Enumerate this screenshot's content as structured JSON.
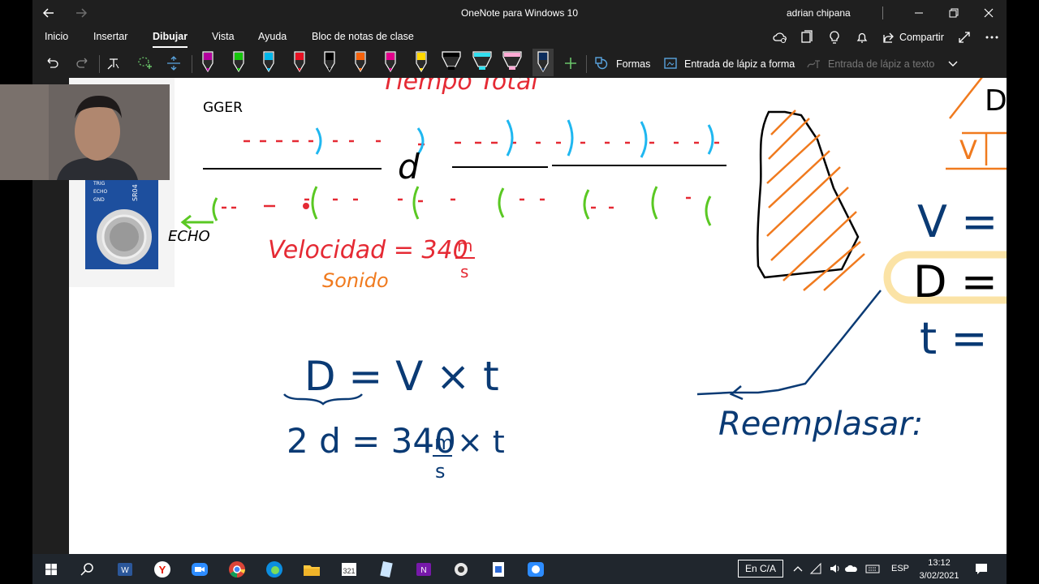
{
  "window": {
    "title": "OneNote para Windows 10",
    "user": "adrian chipana"
  },
  "menu": {
    "tabs": [
      "Inicio",
      "Insertar",
      "Dibujar",
      "Vista",
      "Ayuda",
      "Bloc de notas de clase"
    ],
    "active_tab": "Dibujar",
    "share_label": "Compartir"
  },
  "toolbar": {
    "shapes_label": "Formas",
    "ink_to_shape_label": "Entrada de lápiz a forma",
    "ink_to_text_label": "Entrada de lápiz a texto",
    "pens": [
      {
        "name": "pen-magenta",
        "color": "#b4009e"
      },
      {
        "name": "pen-green",
        "color": "#16c60c"
      },
      {
        "name": "pen-cyan",
        "color": "#00b7eb"
      },
      {
        "name": "pen-red",
        "color": "#e81123"
      },
      {
        "name": "pen-black",
        "color": "#000000"
      },
      {
        "name": "pen-orange",
        "color": "#f7630c"
      },
      {
        "name": "pen-pink",
        "color": "#e3008c"
      },
      {
        "name": "pen-yellow",
        "color": "#ffd800"
      },
      {
        "name": "highlighter-black",
        "color": "#000000"
      },
      {
        "name": "highlighter-cyan",
        "color": "#33e0f0"
      },
      {
        "name": "highlighter-pink",
        "color": "#ffaad4"
      },
      {
        "name": "pen-navy",
        "color": "#0b2c5c"
      }
    ]
  },
  "ink": {
    "title_fragment": "Tiempo  Total",
    "trigger_fragment": "GGER",
    "d_label": "d",
    "velocity_label": "Velocidad = 340",
    "velocity_unit_num": "m",
    "velocity_unit_den": "s",
    "sound_label": "Sonido",
    "echo_label": "ECHO",
    "formula_1": "D = V × t",
    "formula_2": "2 d = 340",
    "formula_2_unit_num": "m",
    "formula_2_unit_den": "s",
    "formula_2_tail": "× t",
    "replace_label": "Reemplasar:",
    "right_v": "V =",
    "right_d": "D =",
    "right_t": "t =",
    "triangle_top": "D",
    "triangle_left": "V"
  },
  "sensor": {
    "pins": [
      "TRIG",
      "ECHO",
      "GND"
    ],
    "model": "SR04"
  },
  "taskbar": {
    "ime_label": "En C/A",
    "language": "ESP",
    "time": "13:12",
    "date": "3/02/2021"
  },
  "colors": {
    "accent": "#76b9ed",
    "ink_red": "#e52a34",
    "ink_orange": "#f07a1e",
    "ink_blue": "#0a3a74",
    "ink_cyan": "#1fb7f0",
    "ink_green": "#5ac823"
  }
}
